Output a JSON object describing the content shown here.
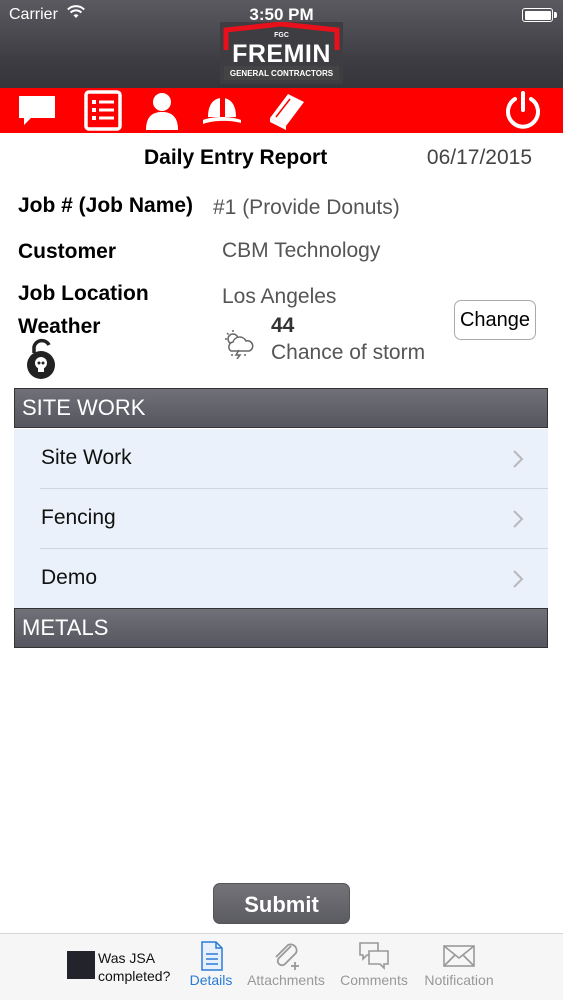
{
  "status_bar": {
    "carrier": "Carrier",
    "time": "3:50 PM"
  },
  "logo": {
    "abbrev": "FGC",
    "name": "FREMIN",
    "subtitle": "GENERAL CONTRACTORS"
  },
  "toolbar": {
    "icons": [
      "chat-icon",
      "list-icon",
      "person-icon",
      "hard-hat-icon",
      "book-icon",
      "power-icon"
    ],
    "color": "#fe0000"
  },
  "report": {
    "title": "Daily Entry Report",
    "date": "06/17/2015",
    "job_label": "Job # (Job Name)",
    "job_value": "#1 (Provide Donuts)",
    "customer_label": "Customer",
    "customer_value": "CBM Technology",
    "location_label": "Job Location",
    "location_value": "Los Angeles",
    "weather_label": "Weather",
    "temperature": "44",
    "forecast": "Chance of storm",
    "change_button": "Change"
  },
  "sections": [
    {
      "title": "SITE WORK",
      "items": [
        "Site Work",
        "Fencing",
        "Demo"
      ]
    },
    {
      "title": "METALS",
      "items": []
    }
  ],
  "submit_label": "Submit",
  "tabbar": {
    "jsa_label": "Was JSA completed?",
    "tabs": [
      {
        "label": "Details",
        "icon": "document-icon",
        "active": true
      },
      {
        "label": "Attachments",
        "icon": "paperclip-icon",
        "active": false
      },
      {
        "label": "Comments",
        "icon": "comments-icon",
        "active": false
      },
      {
        "label": "Notification",
        "icon": "envelope-icon",
        "active": false
      }
    ],
    "active_color": "#2a7bd6"
  }
}
